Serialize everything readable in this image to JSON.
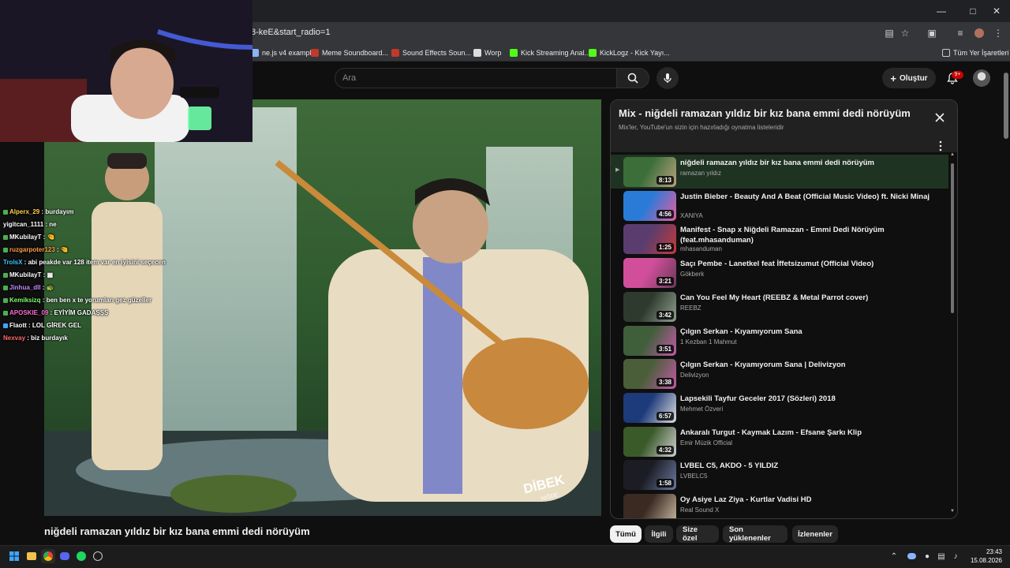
{
  "browser": {
    "url": "8-keE&start_radio=1",
    "bookmarks": [
      {
        "label": "ne.js v4 exampl...",
        "icon": "page-icon",
        "color": "#8ab4f8"
      },
      {
        "label": "Meme Soundboard...",
        "icon": "soundboard-icon",
        "color": "#c0392b"
      },
      {
        "label": "Sound Effects Soun...",
        "icon": "soundboard-icon",
        "color": "#c0392b"
      },
      {
        "label": "Worp",
        "icon": "worp-icon",
        "color": "#dddddd"
      },
      {
        "label": "Kick Streaming Anal...",
        "icon": "kick-icon",
        "color": "#53fc18"
      },
      {
        "label": "KickLogz - Kick Yayı...",
        "icon": "kick-icon",
        "color": "#53fc18"
      }
    ],
    "all_bookmarks": "Tüm Yer İşaretleri"
  },
  "youtube": {
    "search_placeholder": "Ara",
    "create_label": "Oluştur",
    "notification_count": "9+"
  },
  "video": {
    "title": "niğdeli ramazan yıldız bir kız bana emmi dedi nörüyüm",
    "watermark": "DİBEK",
    "watermark_sub": "NİĞDE"
  },
  "chat": [
    {
      "user": "Alperx_29",
      "msg": "burdayım",
      "color": "#ffd24a",
      "badge": "#4caf50"
    },
    {
      "user": "yigitcan_1111",
      "msg": "ne",
      "color": "#ffffff",
      "badge": ""
    },
    {
      "user": "MKubilayT",
      "msg": "🤏",
      "color": "#ffffff",
      "badge": "#4caf50"
    },
    {
      "user": "ruzgarpoter123",
      "msg": "🤏",
      "color": "#ff9f43",
      "badge": "#4caf50"
    },
    {
      "user": "TrolsX",
      "msg": "abi peakde var 128 item var en iyisini seçecen",
      "color": "#3ec7ff",
      "badge": ""
    },
    {
      "user": "MKubilayT",
      "msg": "▦",
      "color": "#ffffff",
      "badge": "#4caf50"
    },
    {
      "user": "Jinhua_dll",
      "msg": "🐢",
      "color": "#c38bff",
      "badge": "#4caf50"
    },
    {
      "user": "Kemiksizq",
      "msg": "ben ben x te yorumları gez güzeller",
      "color": "#7dff6b",
      "badge": "#4caf50"
    },
    {
      "user": "APOSKIE_09",
      "msg": "EYİYİM GADAŞŞŞ",
      "color": "#ff6bd6",
      "badge": "#4caf50"
    },
    {
      "user": "Flaott",
      "msg": "LOL GİREK GEL",
      "color": "#ffffff",
      "badge": "#3ea6ff"
    },
    {
      "user": "Nexvay",
      "msg": "biz burdayık",
      "color": "#ff6b6b",
      "badge": ""
    }
  ],
  "playlist": {
    "title": "Mix - niğdeli ramazan yıldız bir kız bana emmi dedi nörüyüm",
    "subtitle": "Mix'ler, YouTube'un sizin için hazırladığı oynatma listeleridir",
    "items": [
      {
        "title": "niğdeli ramazan yıldız bir kız bana emmi dedi nörüyüm",
        "channel": "ramazan yıldız",
        "duration": "8:13",
        "active": true,
        "thumb": [
          "#3c6e3a",
          "#b9a27e"
        ]
      },
      {
        "title": "Justin Bieber - Beauty And A Beat (Official Music Video) ft. Nicki Minaj",
        "channel": "XANIYA",
        "duration": "4:56",
        "active": false,
        "thumb": [
          "#2a7bd8",
          "#e45ea0"
        ]
      },
      {
        "title": "Manifest - Snap x Niğdeli Ramazan - Emmi Dedi Nörüyüm (feat.mhasanduman)",
        "channel": "mhasanduman",
        "duration": "1:25",
        "active": false,
        "thumb": [
          "#5a3d6e",
          "#c23a3a"
        ]
      },
      {
        "title": "Saçı Pembe - Lanetkel feat İffetsizumut (Official Video)",
        "channel": "Gökberk",
        "duration": "3:21",
        "active": false,
        "thumb": [
          "#d14f9a",
          "#6b3a5a"
        ]
      },
      {
        "title": "Can You Feel My Heart (REEBZ & Metal Parrot cover)",
        "channel": "REEBZ",
        "duration": "3:42",
        "active": false,
        "thumb": [
          "#2f3a2f",
          "#8fa08f"
        ]
      },
      {
        "title": "Çılgın Serkan - Kıyamıyorum Sana",
        "channel": "1 Kezban 1 Mahmut",
        "duration": "3:51",
        "active": false,
        "thumb": [
          "#3f5e3a",
          "#c25aa6"
        ]
      },
      {
        "title": "Çılgın Serkan - Kıyamıyorum Sana | Delivizyon",
        "channel": "Delivizyon",
        "duration": "3:38",
        "active": false,
        "thumb": [
          "#4a5e3a",
          "#c25aa6"
        ]
      },
      {
        "title": "Lapsekili Tayfur Geceler 2017 (Sözleri) 2018",
        "channel": "Mehmet Özveri",
        "duration": "6:57",
        "active": false,
        "thumb": [
          "#1d3a7a",
          "#dddddd"
        ]
      },
      {
        "title": "Ankaralı Turgut - Kaymak Lazım - Efsane Şarkı Klip",
        "channel": "Emir Müzik Official",
        "duration": "4:32",
        "active": false,
        "thumb": [
          "#3a5a2a",
          "#d0d0d0"
        ]
      },
      {
        "title": "LVBEL C5, AKDO - 5 YILDIZ",
        "channel": "LVBELC5",
        "duration": "1:58",
        "active": false,
        "thumb": [
          "#1c1c24",
          "#6a7aa0"
        ]
      },
      {
        "title": "Oy Asiye Laz Ziya - Kurtlar Vadisi HD",
        "channel": "Real Sound X",
        "duration": "",
        "active": false,
        "thumb": [
          "#3a2a22",
          "#c8b8a0"
        ]
      }
    ]
  },
  "chips": [
    "Tümü",
    "İlgili",
    "Size özel",
    "Son yüklenenler",
    "İzlenenler"
  ],
  "taskbar": {
    "time": "23:43",
    "date": "15.08.2026"
  }
}
